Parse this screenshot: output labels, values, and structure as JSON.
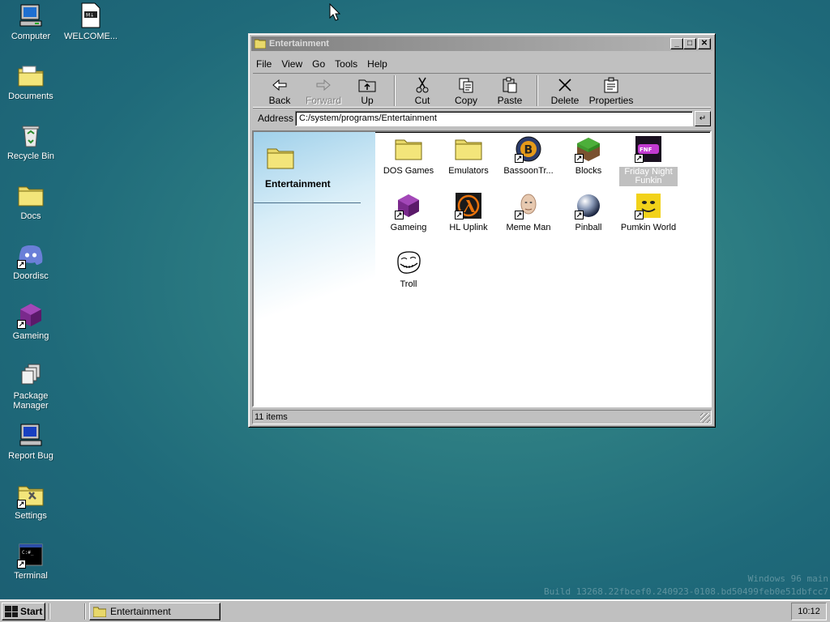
{
  "desktop": {
    "icons": [
      {
        "label": "Computer",
        "icon": "computer-icon"
      },
      {
        "label": "WELCOME...",
        "icon": "markdown-file-icon"
      },
      {
        "label": "Documents",
        "icon": "documents-folder-icon"
      },
      {
        "label": "Recycle Bin",
        "icon": "recycle-bin-icon"
      },
      {
        "label": "Docs",
        "icon": "folder-icon"
      },
      {
        "label": "Doordisc",
        "icon": "discord-icon"
      },
      {
        "label": "Gameing",
        "icon": "purple-cube-icon"
      },
      {
        "label": "Package Manager",
        "icon": "package-icon"
      },
      {
        "label": "Report Bug",
        "icon": "computer-icon"
      },
      {
        "label": "Settings",
        "icon": "settings-icon"
      },
      {
        "label": "Terminal",
        "icon": "terminal-icon"
      }
    ],
    "watermark_line1": "Windows 96 main",
    "watermark_line2": "Build 13268.22fbcef0.240923-0108.bd50499feb0e51dbfcc7"
  },
  "window": {
    "title": "Entertainment",
    "menu": [
      "File",
      "View",
      "Go",
      "Tools",
      "Help"
    ],
    "toolbar": {
      "back": "Back",
      "forward": "Forward",
      "up": "Up",
      "cut": "Cut",
      "copy": "Copy",
      "paste": "Paste",
      "delete": "Delete",
      "properties": "Properties"
    },
    "address_label": "Address",
    "address_value": "C:/system/programs/Entertainment",
    "sidebar_title": "Entertainment",
    "files": [
      {
        "label": "DOS Games",
        "icon": "folder-icon"
      },
      {
        "label": "Emulators",
        "icon": "folder-icon"
      },
      {
        "label": "BassoonTr...",
        "icon": "bassoon-icon"
      },
      {
        "label": "Blocks",
        "icon": "grass-block-icon"
      },
      {
        "label": "Friday Night Funkin",
        "icon": "fnf-icon"
      },
      {
        "label": "Gameing",
        "icon": "purple-cube-icon"
      },
      {
        "label": "HL Uplink",
        "icon": "half-life-icon"
      },
      {
        "label": "Meme Man",
        "icon": "meme-man-icon"
      },
      {
        "label": "Pinball",
        "icon": "pinball-icon"
      },
      {
        "label": "Pumkin World",
        "icon": "pumpkin-face-icon"
      },
      {
        "label": "Troll",
        "icon": "troll-face-icon"
      }
    ],
    "status": "11 items"
  },
  "taskbar": {
    "start_label": "Start",
    "task_label": "Entertainment",
    "clock": "10:12"
  }
}
